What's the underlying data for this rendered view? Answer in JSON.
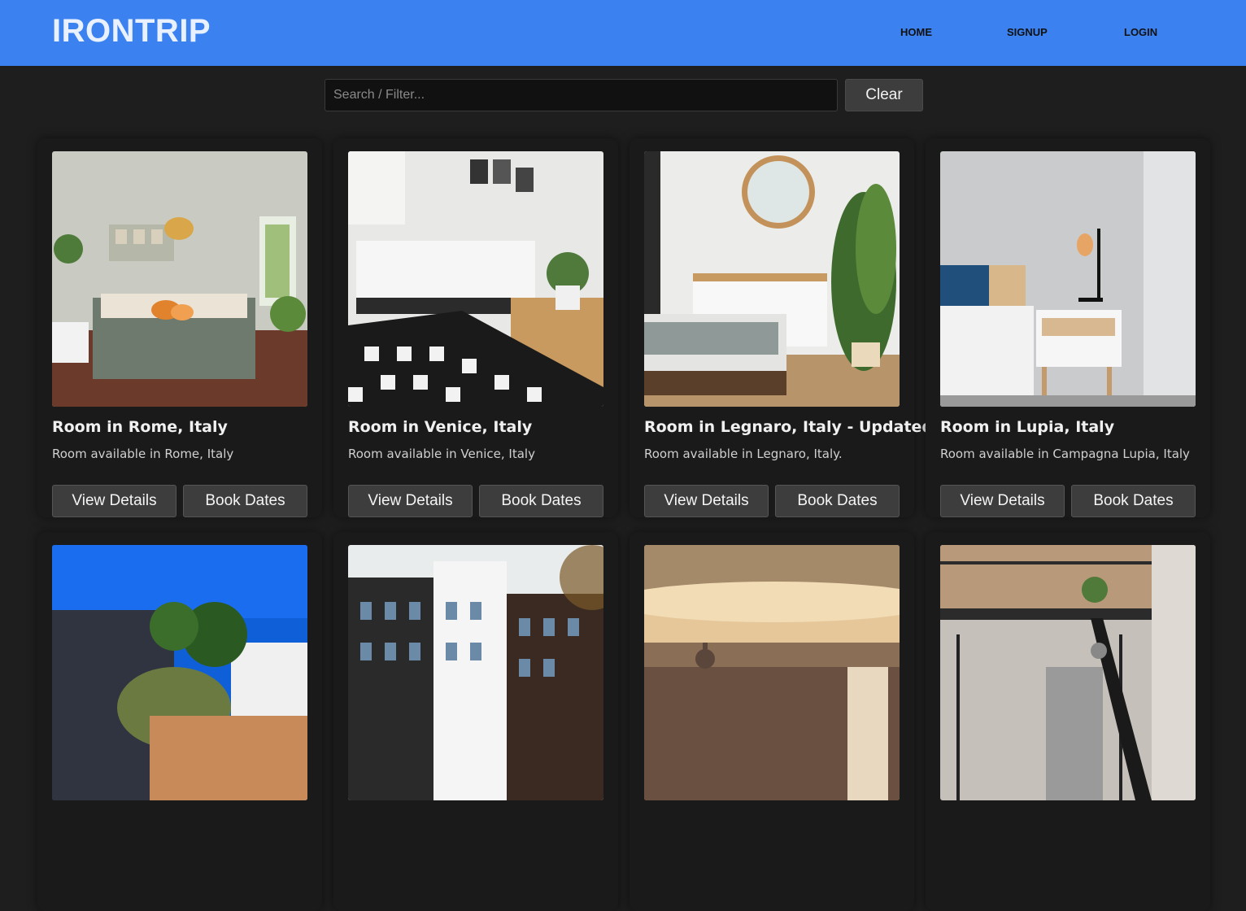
{
  "header": {
    "brand": "IRONTRIP",
    "nav": [
      {
        "label": "HOME"
      },
      {
        "label": "SIGNUP"
      },
      {
        "label": "LOGIN"
      }
    ],
    "color": "#3b82f0"
  },
  "search": {
    "placeholder": "Search / Filter...",
    "value": "",
    "clear_label": "Clear"
  },
  "listings": [
    {
      "title": "Room in Rome, Italy",
      "description": "Room available in Rome, Italy",
      "view_label": "View Details",
      "book_label": "Book Dates",
      "image": "bedroom-green-photo"
    },
    {
      "title": "Room in Venice, Italy",
      "description": "Room available in Venice, Italy",
      "view_label": "View Details",
      "book_label": "Book Dates",
      "image": "bedroom-geometric-rug-photo"
    },
    {
      "title": "Room in Legnaro, Italy - Updated",
      "description": "Room available in Legnaro, Italy.",
      "view_label": "View Details",
      "book_label": "Book Dates",
      "image": "bedroom-mirror-plant-photo"
    },
    {
      "title": "Room in Lupia, Italy",
      "description": "Room available in Campagna Lupia, Italy",
      "view_label": "View Details",
      "book_label": "Book Dates",
      "image": "bedroom-lamp-nightstand-photo"
    },
    {
      "title": "",
      "description": "",
      "view_label": "",
      "book_label": "",
      "image": "house-palm-photo"
    },
    {
      "title": "",
      "description": "",
      "view_label": "",
      "book_label": "",
      "image": "canal-houses-photo"
    },
    {
      "title": "",
      "description": "",
      "view_label": "",
      "book_label": "",
      "image": "city-skyline-photo"
    },
    {
      "title": "",
      "description": "",
      "view_label": "",
      "book_label": "",
      "image": "loft-interior-photo"
    }
  ]
}
